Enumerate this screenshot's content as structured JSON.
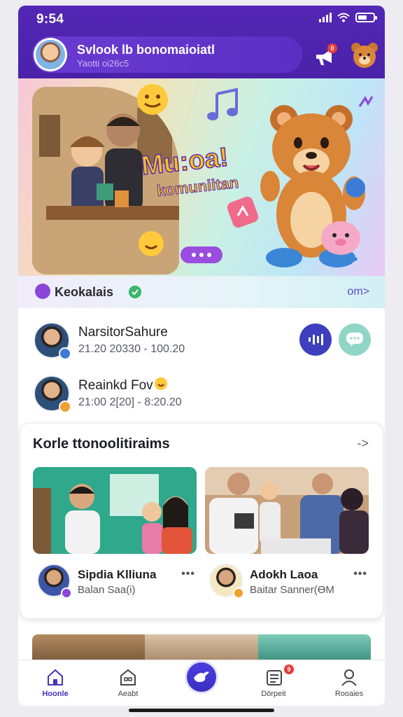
{
  "status_bar": {
    "time": "9:54"
  },
  "header": {
    "title": "Svlook lb bonomaioiatl",
    "subtitle": "Yaotti oi26c5",
    "notification_count": "0"
  },
  "banner": {
    "title": "Mu:oa!",
    "subtitle": "komuniitan"
  },
  "category": {
    "label": "Keokalais",
    "more_label": "om>"
  },
  "live_items": [
    {
      "name": "NarsitorSahure",
      "time": "21.20 20330 - 100.20"
    },
    {
      "name": "Reainkd Fov",
      "time": "21:00 2[20] - 8:20.20"
    }
  ],
  "panel": {
    "title": "Korle ttonoolitiraims",
    "more_label": "->",
    "cards": [
      {
        "name": "Sipdia Klliuna",
        "subtitle": "Balan Saa(i)"
      },
      {
        "name": "Adokh Laoa",
        "subtitle": "Baitar Sanner(ӨM"
      }
    ]
  },
  "tabbar": {
    "items": [
      {
        "label": "Hoonle"
      },
      {
        "label": "Aeabt"
      },
      {
        "label": "Dörpeit"
      },
      {
        "label": "Rooaies"
      }
    ],
    "badge_count": "9"
  },
  "colors": {
    "primary": "#4a22a8",
    "accent": "#5a4cd0",
    "badge_red": "#e63b3b",
    "teal": "#8fd6c6"
  }
}
